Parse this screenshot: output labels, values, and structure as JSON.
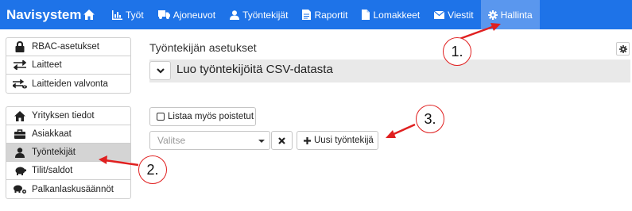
{
  "navbar": {
    "brand": "Navisystem",
    "items": [
      {
        "label": "",
        "icon": "home-icon"
      },
      {
        "label": "Työt",
        "icon": "chart-icon"
      },
      {
        "label": "Ajoneuvot",
        "icon": "truck-icon"
      },
      {
        "label": "Työntekijät",
        "icon": "user-icon"
      },
      {
        "label": "Raportit",
        "icon": "report-icon"
      },
      {
        "label": "Lomakkeet",
        "icon": "document-icon"
      },
      {
        "label": "Viestit",
        "icon": "envelope-icon"
      },
      {
        "label": "Hallinta",
        "icon": "gear-icon",
        "active": true
      }
    ]
  },
  "sidebar": {
    "group1": [
      {
        "label": "RBAC-asetukset",
        "icon": "lock-icon"
      },
      {
        "label": "Laitteet",
        "icon": "exchange-icon"
      },
      {
        "label": "Laitteiden valvonta",
        "icon": "exchange-eye-icon"
      }
    ],
    "group2": [
      {
        "label": "Yrityksen tiedot",
        "icon": "home-icon"
      },
      {
        "label": "Asiakkaat",
        "icon": "briefcase-icon"
      },
      {
        "label": "Työntekijät",
        "icon": "user-icon",
        "active": true
      },
      {
        "label": "Tilit/saldot",
        "icon": "piggy-bank-icon"
      },
      {
        "label": "Palkanlaskusäännöt",
        "icon": "piggy-bank-gear-icon"
      }
    ]
  },
  "main": {
    "title": "Työntekijän asetukset",
    "collapse_title": "Luo työntekijöitä CSV-datasta",
    "show_deleted_label": "Listaa myös poistetut",
    "select_placeholder": "Valitse",
    "new_employee_label": "Uusi työntekijä"
  },
  "annotations": [
    "1.",
    "2.",
    "3."
  ],
  "colors": {
    "navbar": "#1e73e8",
    "navbar_active": "#5a97ee",
    "annotation": "#e02020"
  }
}
